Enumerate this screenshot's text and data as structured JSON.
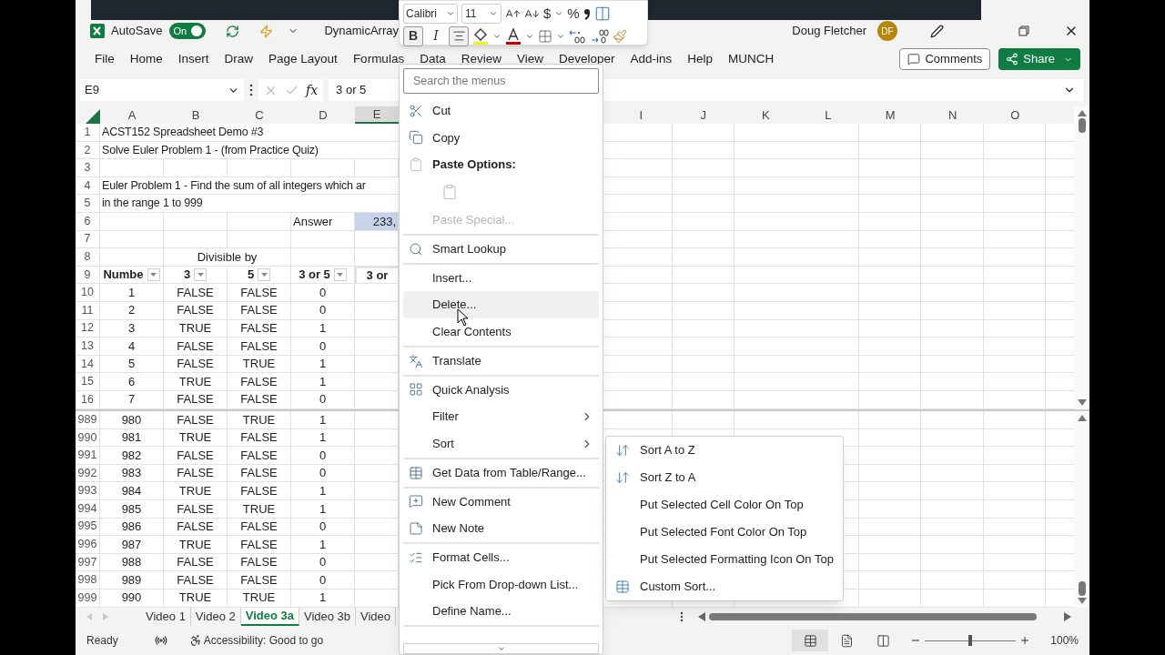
{
  "title_bar": {
    "autosave_label": "AutoSave",
    "autosave_on": true,
    "autosave_state": "On",
    "file_name": "DynamicArray",
    "user_name": "Doug Fletcher",
    "avatar_initials": "DF"
  },
  "mini_toolbar": {
    "font": "Calibri",
    "size": "11",
    "currency": "$",
    "percent": "%",
    "bold": "B",
    "italic": "I",
    "bold_pressed": true,
    "center_pressed": true
  },
  "ribbon_tabs": [
    "File",
    "Home",
    "Insert",
    "Draw",
    "Page Layout",
    "Formulas",
    "Data",
    "Review",
    "View",
    "Developer",
    "Add-ins",
    "Help",
    "MUNCH"
  ],
  "comments_button": "Comments",
  "share_button": "Share",
  "formula_bar": {
    "name_box": "E9",
    "fx_label": "fx",
    "formula": "3 or 5"
  },
  "columns": [
    {
      "label": "A",
      "selected": false
    },
    {
      "label": "B",
      "selected": false
    },
    {
      "label": "C",
      "selected": false
    },
    {
      "label": "D",
      "selected": false
    },
    {
      "label": "E",
      "selected": true
    },
    {
      "label": "I",
      "selected": false
    },
    {
      "label": "J",
      "selected": false
    },
    {
      "label": "K",
      "selected": false
    },
    {
      "label": "L",
      "selected": false
    },
    {
      "label": "M",
      "selected": false
    },
    {
      "label": "N",
      "selected": false
    },
    {
      "label": "O",
      "selected": false
    }
  ],
  "rows_top": [
    {
      "n": "1",
      "kind": "text",
      "a": "ACST152 Spreadsheet Demo #3"
    },
    {
      "n": "2",
      "kind": "text",
      "a": "Solve Euler Problem 1 - (from Practice Quiz)"
    },
    {
      "n": "3",
      "kind": "blank"
    },
    {
      "n": "4",
      "kind": "text",
      "a": "Euler Problem 1 - Find the sum of all integers which ar"
    },
    {
      "n": "5",
      "kind": "text",
      "a": "in the range 1 to 999"
    },
    {
      "n": "6",
      "kind": "answer",
      "d": "Answer",
      "e": "233,"
    },
    {
      "n": "7",
      "kind": "blank"
    },
    {
      "n": "8",
      "kind": "group",
      "b": "Divisible by"
    },
    {
      "n": "9",
      "kind": "header",
      "a": "Numbe",
      "b": "3",
      "c": "5",
      "d": "3 or 5",
      "e": "3 or",
      "e_selected": true
    },
    {
      "n": "10",
      "kind": "data",
      "a": "1",
      "b": "FALSE",
      "c": "FALSE",
      "d": "0"
    },
    {
      "n": "11",
      "kind": "data",
      "a": "2",
      "b": "FALSE",
      "c": "FALSE",
      "d": "0"
    },
    {
      "n": "12",
      "kind": "data",
      "a": "3",
      "b": "TRUE",
      "c": "FALSE",
      "d": "1"
    },
    {
      "n": "13",
      "kind": "data",
      "a": "4",
      "b": "FALSE",
      "c": "FALSE",
      "d": "0"
    },
    {
      "n": "14",
      "kind": "data",
      "a": "5",
      "b": "FALSE",
      "c": "TRUE",
      "d": "1"
    },
    {
      "n": "15",
      "kind": "data",
      "a": "6",
      "b": "TRUE",
      "c": "FALSE",
      "d": "1"
    },
    {
      "n": "16",
      "kind": "data",
      "a": "7",
      "b": "FALSE",
      "c": "FALSE",
      "d": "0"
    }
  ],
  "rows_bottom": [
    {
      "n": "989",
      "kind": "data",
      "a": "980",
      "b": "FALSE",
      "c": "TRUE",
      "d": "1"
    },
    {
      "n": "990",
      "kind": "data",
      "a": "981",
      "b": "TRUE",
      "c": "FALSE",
      "d": "1"
    },
    {
      "n": "991",
      "kind": "data",
      "a": "982",
      "b": "FALSE",
      "c": "FALSE",
      "d": "0"
    },
    {
      "n": "992",
      "kind": "data",
      "a": "983",
      "b": "FALSE",
      "c": "FALSE",
      "d": "0"
    },
    {
      "n": "993",
      "kind": "data",
      "a": "984",
      "b": "TRUE",
      "c": "FALSE",
      "d": "1"
    },
    {
      "n": "994",
      "kind": "data",
      "a": "985",
      "b": "FALSE",
      "c": "TRUE",
      "d": "1"
    },
    {
      "n": "995",
      "kind": "data",
      "a": "986",
      "b": "FALSE",
      "c": "FALSE",
      "d": "0"
    },
    {
      "n": "996",
      "kind": "data",
      "a": "987",
      "b": "TRUE",
      "c": "FALSE",
      "d": "1"
    },
    {
      "n": "997",
      "kind": "data",
      "a": "988",
      "b": "FALSE",
      "c": "FALSE",
      "d": "0"
    },
    {
      "n": "998",
      "kind": "data",
      "a": "989",
      "b": "FALSE",
      "c": "FALSE",
      "d": "0"
    },
    {
      "n": "999",
      "kind": "data",
      "a": "990",
      "b": "TRUE",
      "c": "TRUE",
      "d": "1"
    }
  ],
  "context_menu": {
    "placeholder": "Search the menus",
    "items": [
      {
        "kind": "item",
        "label": "Cut",
        "disabled": false,
        "highlighted": false,
        "submenu": false,
        "separator_after": false
      },
      {
        "kind": "item",
        "label": "Copy",
        "disabled": false,
        "highlighted": false,
        "submenu": false,
        "separator_after": false
      },
      {
        "kind": "heading",
        "label": "Paste Options:"
      },
      {
        "kind": "paste_options"
      },
      {
        "kind": "item",
        "label": "Paste Special...",
        "disabled": true,
        "highlighted": false,
        "submenu": false,
        "separator_after": true
      },
      {
        "kind": "item",
        "label": "Smart Lookup",
        "disabled": false,
        "highlighted": false,
        "submenu": false,
        "separator_after": true
      },
      {
        "kind": "item",
        "label": "Insert...",
        "disabled": false,
        "highlighted": false,
        "submenu": false,
        "separator_after": false
      },
      {
        "kind": "item",
        "label": "Delete...",
        "disabled": false,
        "highlighted": true,
        "submenu": false,
        "separator_after": false
      },
      {
        "kind": "item",
        "label": "Clear Contents",
        "disabled": false,
        "highlighted": false,
        "submenu": false,
        "separator_after": true
      },
      {
        "kind": "item",
        "label": "Translate",
        "disabled": false,
        "highlighted": false,
        "submenu": false,
        "separator_after": true
      },
      {
        "kind": "item",
        "label": "Quick Analysis",
        "disabled": false,
        "highlighted": false,
        "submenu": false,
        "separator_after": false
      },
      {
        "kind": "item",
        "label": "Filter",
        "disabled": false,
        "highlighted": false,
        "submenu": true,
        "separator_after": false
      },
      {
        "kind": "item",
        "label": "Sort",
        "disabled": false,
        "highlighted": false,
        "submenu": true,
        "separator_after": true
      },
      {
        "kind": "item",
        "label": "Get Data from Table/Range...",
        "disabled": false,
        "highlighted": false,
        "submenu": false,
        "separator_after": true
      },
      {
        "kind": "item",
        "label": "New Comment",
        "disabled": false,
        "highlighted": false,
        "submenu": false,
        "separator_after": false
      },
      {
        "kind": "item",
        "label": "New Note",
        "disabled": false,
        "highlighted": false,
        "submenu": false,
        "separator_after": true
      },
      {
        "kind": "item",
        "label": "Format Cells...",
        "disabled": false,
        "highlighted": false,
        "submenu": false,
        "separator_after": false
      },
      {
        "kind": "item",
        "label": "Pick From Drop-down List...",
        "disabled": false,
        "highlighted": false,
        "submenu": false,
        "separator_after": false
      },
      {
        "kind": "item",
        "label": "Define Name...",
        "disabled": false,
        "highlighted": false,
        "submenu": false,
        "separator_after": true
      }
    ]
  },
  "sort_submenu": [
    "Sort A to Z",
    "Sort Z to A",
    "Put Selected Cell Color On Top",
    "Put Selected Font Color On Top",
    "Put Selected Formatting Icon On Top",
    "Custom Sort..."
  ],
  "sheet_tabs": [
    {
      "label": "Video 1",
      "selected": false
    },
    {
      "label": "Video 2",
      "selected": false
    },
    {
      "label": "Video 3a",
      "selected": true
    },
    {
      "label": "Video 3b",
      "selected": false
    },
    {
      "label": "Video",
      "selected": false
    }
  ],
  "status_bar": {
    "ready": "Ready",
    "accessibility": "Accessibility: Good to go",
    "views": [
      {
        "selected": true
      },
      {
        "selected": false
      },
      {
        "selected": false
      }
    ],
    "zoom_slider": {
      "level": 0.5
    },
    "zoom": "100%"
  }
}
